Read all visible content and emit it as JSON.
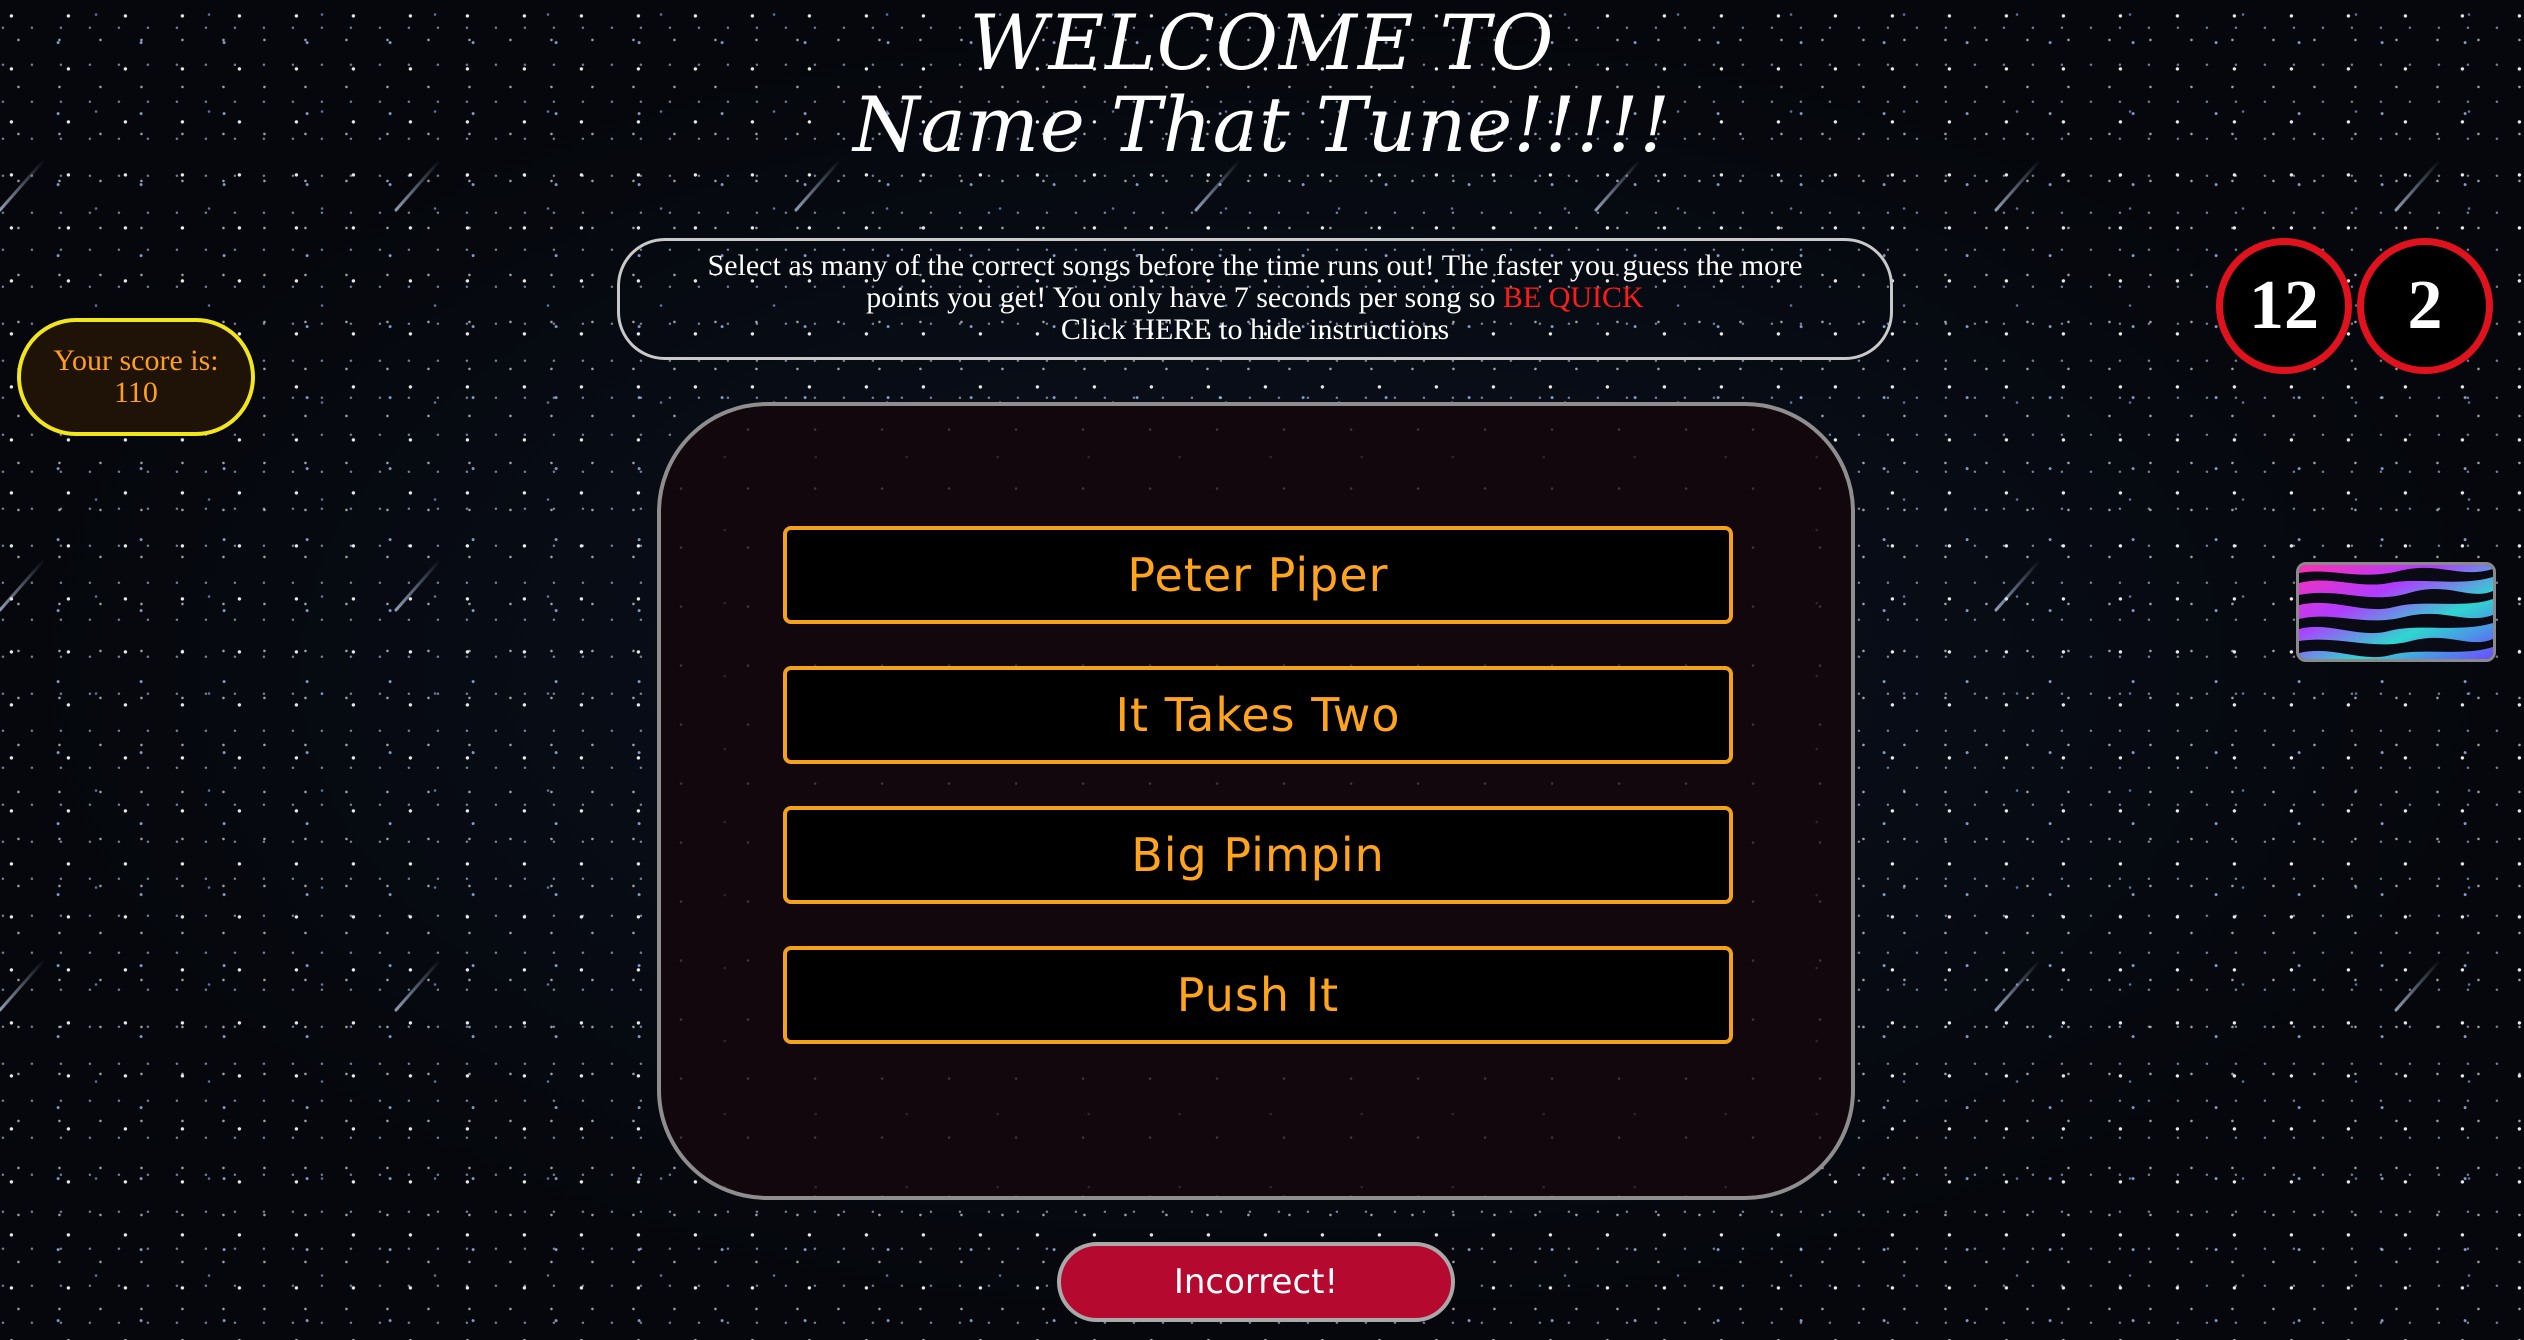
{
  "header": {
    "title_line1": "WELCOME TO",
    "title_line2": "Name That Tune!!!!!"
  },
  "instructions": {
    "line1": "Select as many of the correct songs before the time runs out! The faster you guess the more",
    "line2_prefix": "points you get! You only have 7 seconds per song so ",
    "line2_emphasis": "BE QUICK",
    "toggle": "Click HERE to hide instructions",
    "emphasis_color": "#ff1a1a"
  },
  "score": {
    "text": "Your score is: 110"
  },
  "timers": {
    "first": "12",
    "second": "2",
    "ring_color": "#e0121d"
  },
  "thumbnail": {
    "icon": "zebra-pattern-image"
  },
  "choices": [
    {
      "label": "Peter Piper"
    },
    {
      "label": "It Takes Two"
    },
    {
      "label": "Big Pimpin"
    },
    {
      "label": "Push It"
    }
  ],
  "feedback": {
    "text": "Incorrect!",
    "color": "#b5092f"
  },
  "colors": {
    "accent": "#ffa41c",
    "score_border": "#f1e51c"
  }
}
